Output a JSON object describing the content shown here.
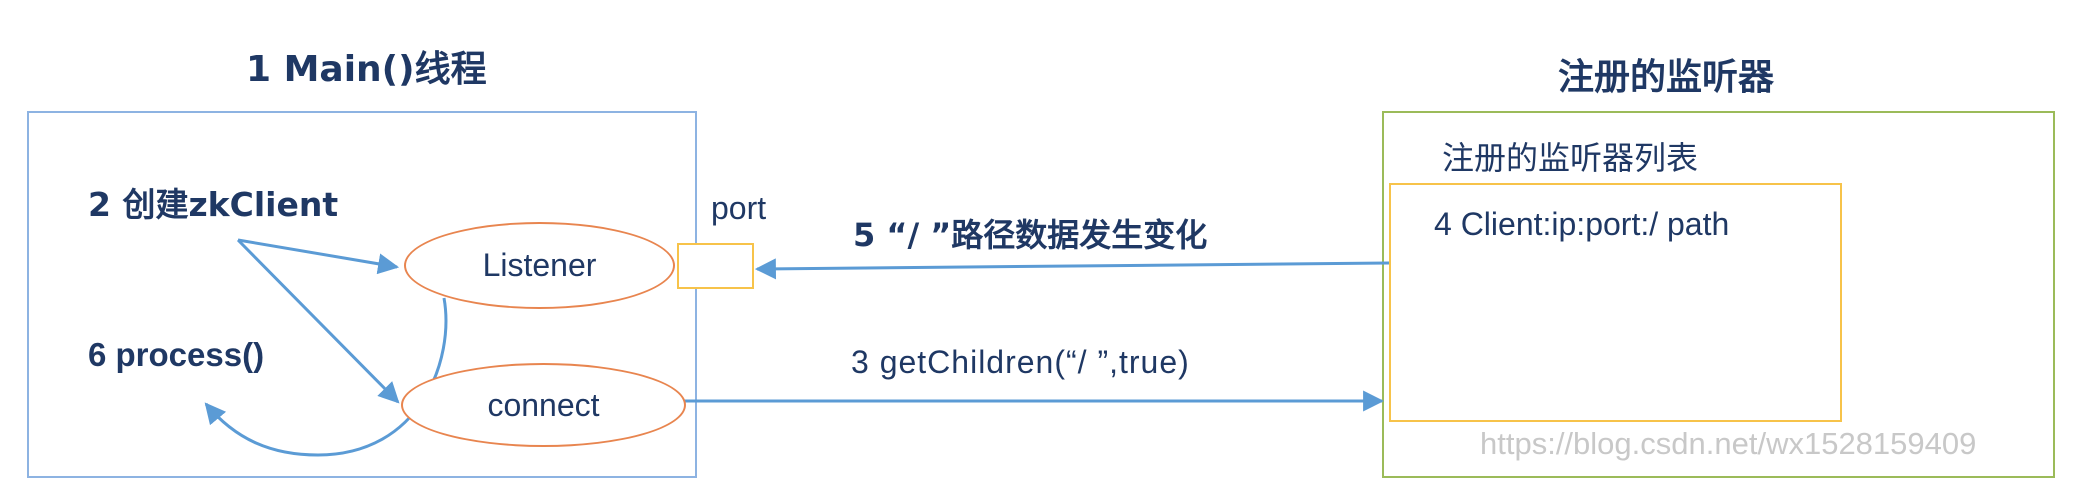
{
  "titles": {
    "main_thread": "1 Main()线程",
    "registered_listener": "注册的监听器"
  },
  "main_box": {
    "create_client": "2 创建zkClient",
    "process": "6 process()",
    "listener": "Listener",
    "connect": "connect"
  },
  "port_label": "port",
  "arrows": {
    "data_change": "5 “/ ”路径数据发生变化",
    "get_children": "3 getChildren(“/ ”,true)"
  },
  "listener_panel": {
    "list_title": "注册的监听器列表",
    "entry": "4 Client:ip:port:/ path"
  },
  "watermark": "https://blog.csdn.net/wx1528159409",
  "colors": {
    "text": "#1f3864",
    "arrow": "#5b9bd5",
    "main_border": "#8db3e2",
    "listener_border": "#9bbb59",
    "list_border": "#f7c34a",
    "ellipse_border": "#e8854f"
  }
}
